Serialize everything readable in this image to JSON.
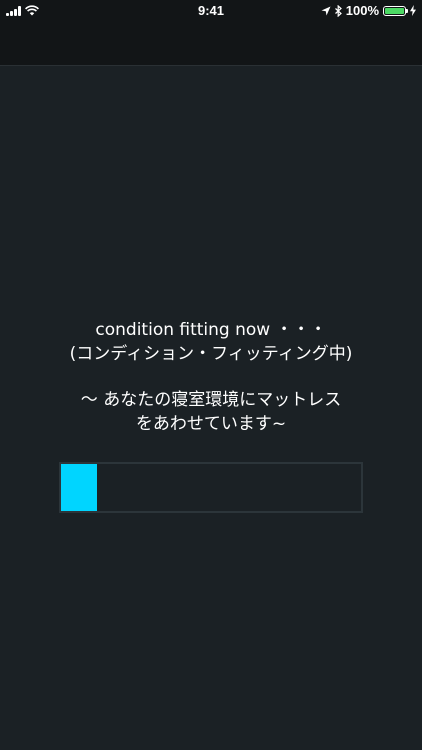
{
  "status_bar": {
    "time": "9:41",
    "battery_percent": "100%",
    "icons": [
      "signal-icon",
      "wifi-icon",
      "location-icon",
      "bluetooth-icon",
      "battery-icon",
      "charging-icon"
    ]
  },
  "message": {
    "line1": "condition fitting now ・・・",
    "line2": "(コンディション・フィッティング中)",
    "line3": "～ あなたの寝室環境にマットレス",
    "line4": "をあわせています~"
  },
  "progress": {
    "fraction": 0.12,
    "color": "#00d5ff"
  }
}
